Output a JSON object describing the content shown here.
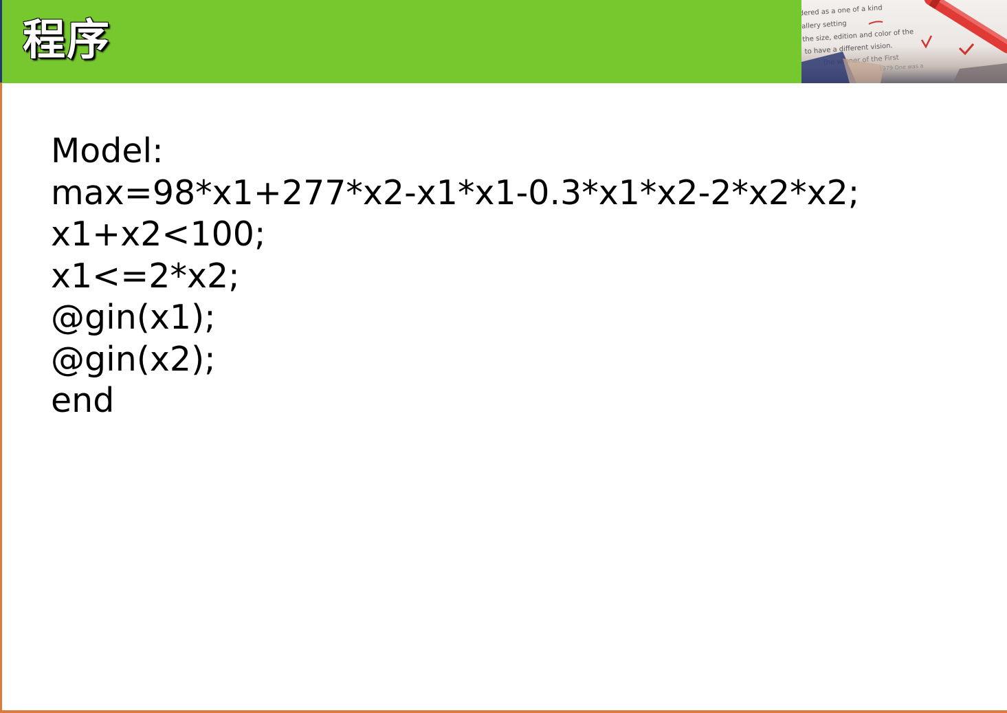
{
  "slide": {
    "title": "程序",
    "colors": {
      "header_green": "#76c82e",
      "accent_orange": "#d97b3a",
      "header_left_edge": "#1f3a6b",
      "text": "#000000",
      "background": "#ffffff"
    },
    "header_image": {
      "icon": "photo-of-proofread-document-with-red-pen",
      "lines": [
        "dered as  a one of a kind",
        "allery setting",
        "the size, edition and color of the",
        "to have a different vision.",
        "the winner of the First",
        "1979  One was a"
      ]
    }
  },
  "code": {
    "lines": [
      "Model:",
      "max=98*x1+277*x2-x1*x1-0.3*x1*x2-2*x2*x2;",
      "x1+x2<100;",
      "x1<=2*x2;",
      "@gin(x1);",
      "@gin(x2);",
      "end"
    ]
  }
}
